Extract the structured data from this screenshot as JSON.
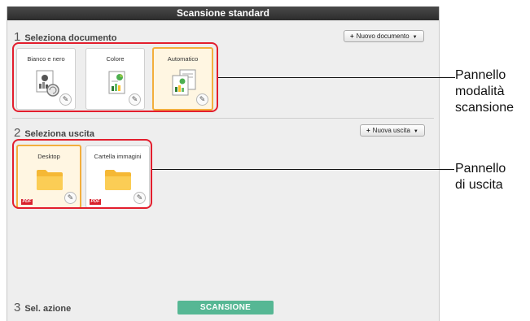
{
  "window": {
    "title": "Scansione standard"
  },
  "sections": {
    "document": {
      "number": "1",
      "label": "Seleziona documento",
      "add_button": "Nuovo documento"
    },
    "output": {
      "number": "2",
      "label": "Seleziona uscita",
      "add_button": "Nuova uscita"
    },
    "action": {
      "number": "3",
      "label": "Sel. azione",
      "scan_button": "SCANSIONE"
    }
  },
  "scan_modes": [
    {
      "label": "Bianco e nero",
      "selected": false
    },
    {
      "label": "Colore",
      "selected": false
    },
    {
      "label": "Automatico",
      "selected": true
    }
  ],
  "outputs": [
    {
      "label": "Desktop",
      "badge": "PDF",
      "selected": true
    },
    {
      "label": "Cartella immagini",
      "badge": "PDF",
      "selected": false
    }
  ],
  "callouts": {
    "scan_mode_panel": [
      "Pannello",
      "modalità",
      "scansione"
    ],
    "output_panel": [
      "Pannello",
      "di uscita"
    ]
  },
  "colors": {
    "highlight": "#e31e2d",
    "selected_border": "#f3ae3c",
    "scan_button": "#56b794",
    "pdf_badge": "#d9232d"
  }
}
